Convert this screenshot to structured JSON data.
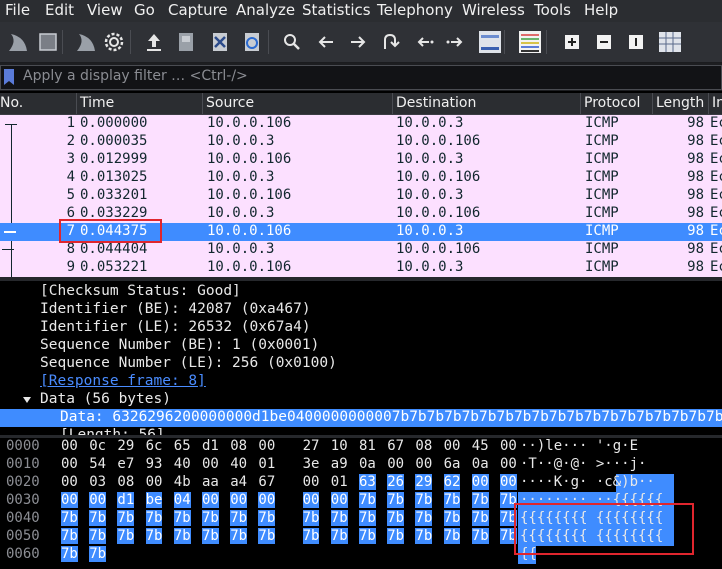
{
  "menu": [
    "File",
    "Edit",
    "View",
    "Go",
    "Capture",
    "Analyze",
    "Statistics",
    "Telephony",
    "Wireless",
    "Tools",
    "Help"
  ],
  "toolbar": {
    "icons": [
      "shark-fin-start-icon",
      "stop-square-icon",
      "shark-fin-restart-icon",
      "gear-options-icon",
      "open-file-icon",
      "save-file-icon",
      "close-file-icon",
      "reload-icon",
      "search-icon",
      "arrow-left-icon",
      "arrow-right-icon",
      "go-to-packet-icon",
      "first-packet-icon",
      "last-packet-icon",
      "autoscroll-icon",
      "colorize-icon",
      "zoom-in-icon",
      "zoom-out-icon",
      "normal-size-icon",
      "resize-columns-icon"
    ]
  },
  "filter": {
    "placeholder": "Apply a display filter … <Ctrl-/>"
  },
  "packet_list": {
    "columns": [
      "No.",
      "Time",
      "Source",
      "Destination",
      "Protocol",
      "Length",
      "In"
    ],
    "rows": [
      {
        "no": "1",
        "time": "0.000000",
        "src": "10.0.0.106",
        "dst": "10.0.0.3",
        "proto": "ICMP",
        "len": "98",
        "info": "Ec"
      },
      {
        "no": "2",
        "time": "0.000035",
        "src": "10.0.0.3",
        "dst": "10.0.0.106",
        "proto": "ICMP",
        "len": "98",
        "info": "Ec"
      },
      {
        "no": "3",
        "time": "0.012999",
        "src": "10.0.0.106",
        "dst": "10.0.0.3",
        "proto": "ICMP",
        "len": "98",
        "info": "Ec"
      },
      {
        "no": "4",
        "time": "0.013025",
        "src": "10.0.0.3",
        "dst": "10.0.0.106",
        "proto": "ICMP",
        "len": "98",
        "info": "Ec"
      },
      {
        "no": "5",
        "time": "0.033201",
        "src": "10.0.0.106",
        "dst": "10.0.0.3",
        "proto": "ICMP",
        "len": "98",
        "info": "Ec"
      },
      {
        "no": "6",
        "time": "0.033229",
        "src": "10.0.0.3",
        "dst": "10.0.0.106",
        "proto": "ICMP",
        "len": "98",
        "info": "Ec"
      },
      {
        "no": "7",
        "time": "0.044375",
        "src": "10.0.0.106",
        "dst": "10.0.0.3",
        "proto": "ICMP",
        "len": "98",
        "info": "Ec",
        "selected": true
      },
      {
        "no": "8",
        "time": "0.044404",
        "src": "10.0.0.3",
        "dst": "10.0.0.106",
        "proto": "ICMP",
        "len": "98",
        "info": "Ec"
      },
      {
        "no": "9",
        "time": "0.053221",
        "src": "10.0.0.106",
        "dst": "10.0.0.3",
        "proto": "ICMP",
        "len": "98",
        "info": "Ec"
      }
    ]
  },
  "details": {
    "lines": [
      "[Checksum Status: Good]",
      "Identifier (BE): 42087 (0xa467)",
      "Identifier (LE): 26532 (0x67a4)",
      "Sequence Number (BE): 1 (0x0001)",
      "Sequence Number (LE): 256 (0x0100)",
      "[Response frame: 8]"
    ],
    "data_node": "Data (56 bytes)",
    "data_value": "Data: 6326296200000000d1be0400000000007b7b7b7b7b7b7b7b7b7b7b7b7b7b7b7b7b7b7b7b7b7b7b7b7b7b7b7b7b7b7b7b7b7b7b7b7b7b7b7b7b7b",
    "data_length_partial": "[Length: 56]"
  },
  "bytes": {
    "offsets": [
      "0000",
      "0010",
      "0020",
      "0030",
      "0040",
      "0050",
      "0060"
    ],
    "hex": [
      [
        "00",
        "0c",
        "29",
        "6c",
        "65",
        "d1",
        "08",
        "00",
        "27",
        "10",
        "81",
        "67",
        "08",
        "00",
        "45",
        "00"
      ],
      [
        "00",
        "54",
        "e7",
        "93",
        "40",
        "00",
        "40",
        "01",
        "3e",
        "a9",
        "0a",
        "00",
        "00",
        "6a",
        "0a",
        "00"
      ],
      [
        "00",
        "03",
        "08",
        "00",
        "4b",
        "aa",
        "a4",
        "67",
        "00",
        "01",
        "63",
        "26",
        "29",
        "62",
        "00",
        "00"
      ],
      [
        "00",
        "00",
        "d1",
        "be",
        "04",
        "00",
        "00",
        "00",
        "00",
        "00",
        "7b",
        "7b",
        "7b",
        "7b",
        "7b",
        "7b"
      ],
      [
        "7b",
        "7b",
        "7b",
        "7b",
        "7b",
        "7b",
        "7b",
        "7b",
        "7b",
        "7b",
        "7b",
        "7b",
        "7b",
        "7b",
        "7b",
        "7b"
      ],
      [
        "7b",
        "7b",
        "7b",
        "7b",
        "7b",
        "7b",
        "7b",
        "7b",
        "7b",
        "7b",
        "7b",
        "7b",
        "7b",
        "7b",
        "7b",
        "7b"
      ],
      [
        "7b",
        "7b"
      ]
    ],
    "ascii": [
      "··)le···  '·g·E",
      "·T··@·@·  >···j·",
      "····K·g·  ·c&)b··",
      "········  ··{{{{{{",
      "{{{{{{{{  {{{{{{{{",
      "{{{{{{{{  {{{{{{{{",
      "{{"
    ]
  },
  "colors": {
    "selection": "#3f8cff",
    "list_bg": "#fce0ff",
    "highlight_box": "#e0262e"
  }
}
